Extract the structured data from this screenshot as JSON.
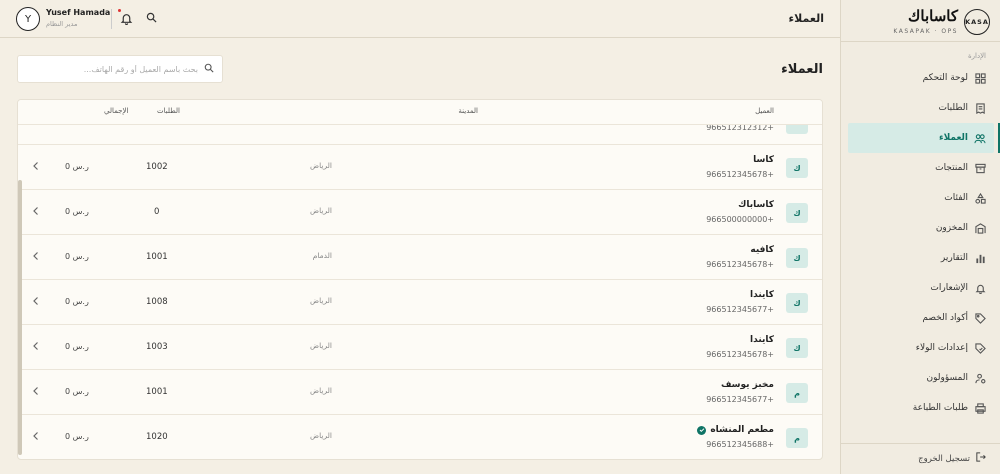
{
  "sidebar": {
    "brand_name": "كاساباك",
    "brand_sub": "KASAPAK · OPS",
    "logo_text": "KASA",
    "section_label": "الإدارة",
    "items": [
      {
        "label": "لوحة التحكم",
        "icon": "grid-icon",
        "active": false
      },
      {
        "label": "الطلبات",
        "icon": "receipt-icon",
        "active": false
      },
      {
        "label": "العملاء",
        "icon": "users-icon",
        "active": true
      },
      {
        "label": "المنتجات",
        "icon": "box-icon",
        "active": false
      },
      {
        "label": "الفئات",
        "icon": "shapes-icon",
        "active": false
      },
      {
        "label": "المخزون",
        "icon": "warehouse-icon",
        "active": false
      },
      {
        "label": "التقارير",
        "icon": "bar-chart-icon",
        "active": false
      },
      {
        "label": "الإشعارات",
        "icon": "bell-icon",
        "active": false
      },
      {
        "label": "أكواد الخصم",
        "icon": "tag-icon",
        "active": false
      },
      {
        "label": "إعدادات الولاء",
        "icon": "loyalty-tag-icon",
        "active": false
      },
      {
        "label": "المسؤولون",
        "icon": "user-settings-icon",
        "active": false
      },
      {
        "label": "طلبات الطباعة",
        "icon": "printer-icon",
        "active": false
      }
    ],
    "logout_label": "تسجيل الخروج"
  },
  "topbar": {
    "title": "العملاء",
    "user_name": "Yusef Hamada",
    "user_role": "مدير النظام",
    "avatar_letter": "Y"
  },
  "page": {
    "title": "العملاء",
    "search_placeholder": "بحث باسم العميل أو رقم الهاتف..."
  },
  "table": {
    "headers": {
      "customer": "العميل",
      "city": "المدينة",
      "orders": "الطلبات",
      "total": "الإجمالي"
    },
    "partial_row_phone": "966512312312+",
    "rows": [
      {
        "badge": "ك",
        "name": "كاسا",
        "phone": "966512345678+",
        "city": "الرياض",
        "orders": "1002",
        "total": "0 ر.س",
        "verified": false
      },
      {
        "badge": "ك",
        "name": "كاساباك",
        "phone": "966500000000+",
        "city": "الرياض",
        "orders": "0",
        "total": "0 ر.س",
        "verified": false
      },
      {
        "badge": "ك",
        "name": "كافيه",
        "phone": "966512345678+",
        "city": "الدمام",
        "orders": "1001",
        "total": "0 ر.س",
        "verified": false
      },
      {
        "badge": "ك",
        "name": "كايندا",
        "phone": "966512345677+",
        "city": "الرياض",
        "orders": "1008",
        "total": "0 ر.س",
        "verified": false
      },
      {
        "badge": "ك",
        "name": "كايندا",
        "phone": "966512345678+",
        "city": "الرياض",
        "orders": "1003",
        "total": "0 ر.س",
        "verified": false
      },
      {
        "badge": "م",
        "name": "مخبز يوسف",
        "phone": "966512345677+",
        "city": "الرياض",
        "orders": "1001",
        "total": "0 ر.س",
        "verified": false
      },
      {
        "badge": "م",
        "name": "مطعم المنشاه",
        "phone": "966512345688+",
        "city": "الرياض",
        "orders": "1020",
        "total": "0 ر.س",
        "verified": true
      }
    ]
  },
  "colors": {
    "accent": "#0f7466",
    "accent_bg": "#d6ebe6",
    "page_bg": "#f4efe4",
    "card_bg": "#fdfbf6"
  }
}
